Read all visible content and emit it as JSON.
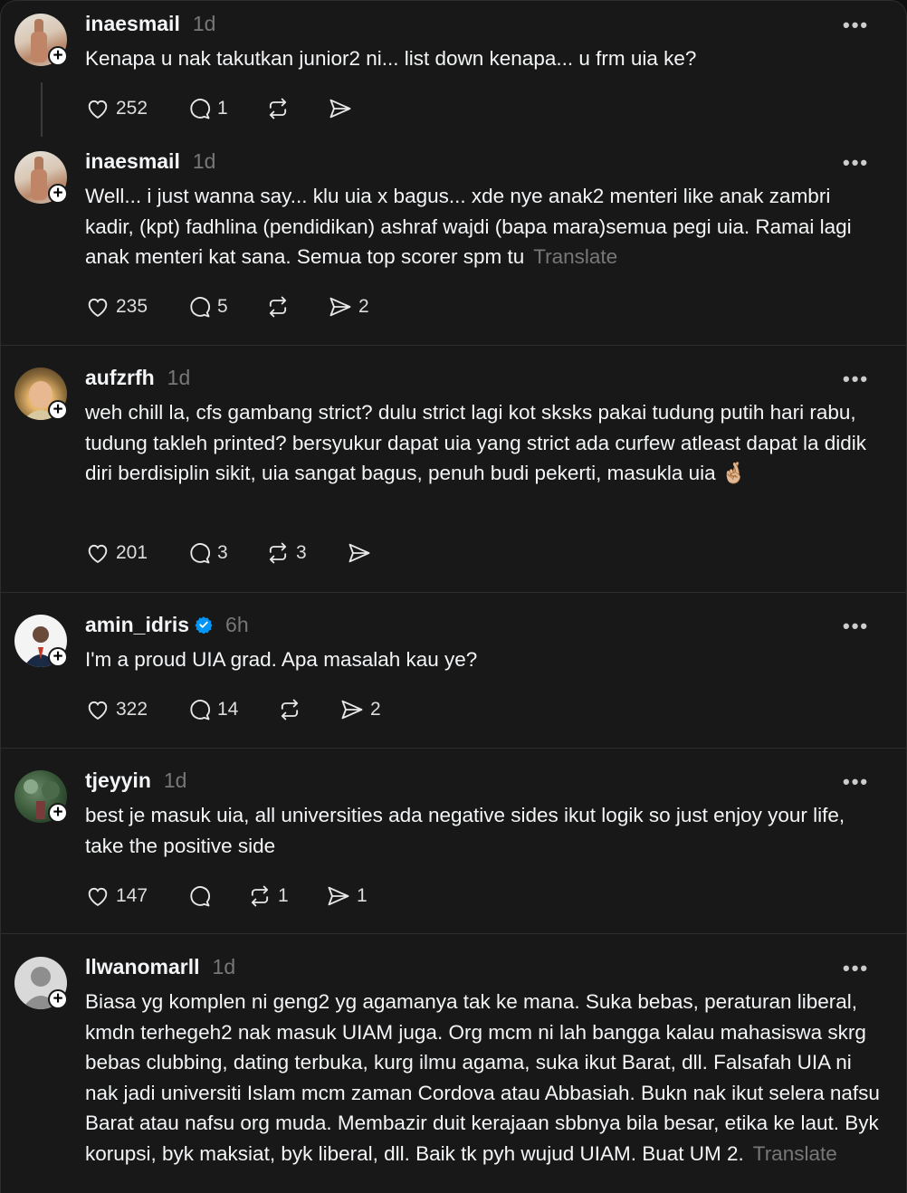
{
  "posts": [
    {
      "username": "inaesmail",
      "time": "1d",
      "text": "Kenapa u nak takutkan junior2 ni... list down kenapa... u frm uia ke?",
      "translate": "",
      "likes": "252",
      "replies": "1",
      "reposts": "",
      "shares": ""
    },
    {
      "username": "inaesmail",
      "time": "1d",
      "text": "Well... i just wanna say... klu uia x bagus... xde nye anak2 menteri like anak zambri kadir, (kpt) fadhlina (pendidikan) ashraf wajdi (bapa mara)semua pegi uia. Ramai lagi anak menteri kat sana. Semua top scorer spm tu",
      "translate": "Translate",
      "likes": "235",
      "replies": "5",
      "reposts": "",
      "shares": "2"
    },
    {
      "username": "aufzrfh",
      "time": "1d",
      "text": "weh chill la, cfs gambang strict? dulu strict lagi kot sksks pakai tudung putih hari rabu, tudung takleh printed? bersyukur dapat uia yang strict ada curfew atleast dapat la didik diri berdisiplin sikit, uia sangat bagus, penuh budi pekerti, masukla uia 🤞🏼",
      "translate": "",
      "likes": "201",
      "replies": "3",
      "reposts": "3",
      "shares": ""
    },
    {
      "username": "amin_idris",
      "time": "6h",
      "text": "I'm a proud UIA grad. Apa masalah kau ye?",
      "translate": "",
      "likes": "322",
      "replies": "14",
      "reposts": "",
      "shares": "2"
    },
    {
      "username": "tjeyyin",
      "time": "1d",
      "text": "best je masuk uia, all universities ada negative sides ikut logik so just enjoy your life, take the positive side",
      "translate": "",
      "likes": "147",
      "replies": "",
      "reposts": "1",
      "shares": "1"
    },
    {
      "username": "llwanomarll",
      "time": "1d",
      "text": "Biasa yg komplen ni geng2 yg agamanya tak ke mana. Suka bebas, peraturan liberal, kmdn terhegeh2 nak masuk UIAM juga. Org mcm ni lah bangga kalau mahasiswa skrg bebas clubbing, dating terbuka, kurg ilmu agama, suka ikut Barat, dll. Falsafah UIA ni nak jadi universiti Islam mcm zaman Cordova atau Abbasiah. Bukn nak ikut selera nafsu Barat atau nafsu org muda. Membazir duit kerajaan sbbnya bila besar, etika ke laut. Byk korupsi, byk maksiat, byk liberal, dll. Baik tk pyh wujud UIAM. Buat UM 2.",
      "translate": "Translate",
      "likes": "",
      "replies": "",
      "reposts": "",
      "shares": ""
    }
  ],
  "more_label": "•••",
  "plus_label": "+",
  "icons": {
    "like": "heart-icon",
    "reply": "comment-icon",
    "repost": "repost-icon",
    "share": "send-icon",
    "verified": "verified-badge-icon"
  },
  "colors": {
    "background": "#181818",
    "text": "#f3f5f7",
    "muted": "#777777",
    "verified": "#0095f6"
  }
}
